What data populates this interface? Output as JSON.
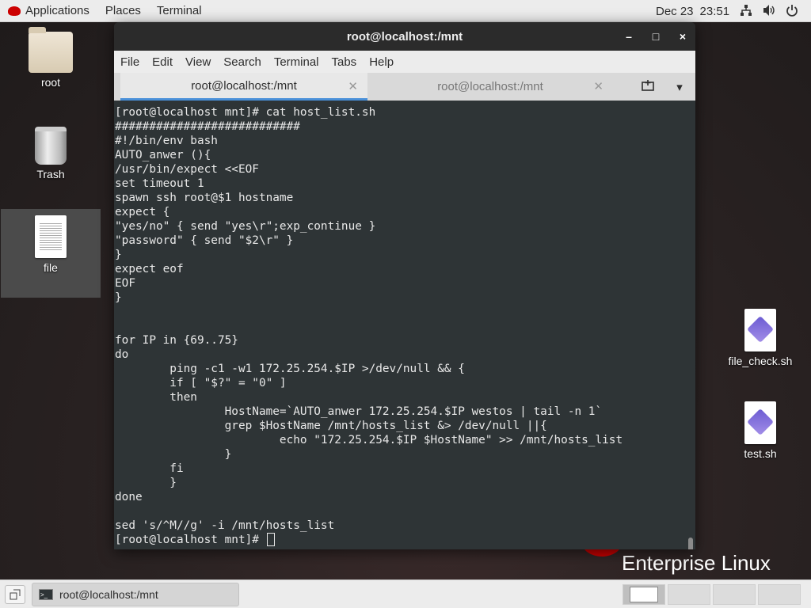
{
  "topbar": {
    "applications": "Applications",
    "places": "Places",
    "terminal": "Terminal",
    "date": "Dec 23",
    "time": "23:51"
  },
  "desktop": {
    "icons": {
      "root": "root",
      "trash": "Trash",
      "file": "file",
      "file_check": "file_check.sh",
      "test": "test.sh"
    },
    "brand": "Enterprise Linux"
  },
  "window": {
    "title": "root@localhost:/mnt",
    "controls": {
      "minimize": "–",
      "maximize": "□",
      "close": "×"
    }
  },
  "menubar": [
    "File",
    "Edit",
    "View",
    "Search",
    "Terminal",
    "Tabs",
    "Help"
  ],
  "tabs": [
    {
      "label": "root@localhost:/mnt",
      "active": true
    },
    {
      "label": "root@localhost:/mnt",
      "active": false
    }
  ],
  "terminal": {
    "lines": [
      "[root@localhost mnt]# cat host_list.sh",
      "###########################",
      "#!/bin/env bash",
      "AUTO_anwer (){",
      "/usr/bin/expect <<EOF",
      "set timeout 1",
      "spawn ssh root@$1 hostname",
      "expect {",
      "\"yes/no\" { send \"yes\\r\";exp_continue }",
      "\"password\" { send \"$2\\r\" }",
      "}",
      "expect eof",
      "EOF",
      "}",
      "",
      "",
      "for IP in {69..75}",
      "do",
      "        ping -c1 -w1 172.25.254.$IP >/dev/null && {",
      "        if [ \"$?\" = \"0\" ]",
      "        then",
      "                HostName=`AUTO_anwer 172.25.254.$IP westos | tail -n 1`",
      "                grep $HostName /mnt/hosts_list &> /dev/null ||{",
      "                        echo \"172.25.254.$IP $HostName\" >> /mnt/hosts_list",
      "                }",
      "        fi",
      "        }",
      "done",
      "",
      "sed 's/^M//g' -i /mnt/hosts_list"
    ],
    "prompt": "[root@localhost mnt]# "
  },
  "taskbar": {
    "window_label": "root@localhost:/mnt"
  }
}
